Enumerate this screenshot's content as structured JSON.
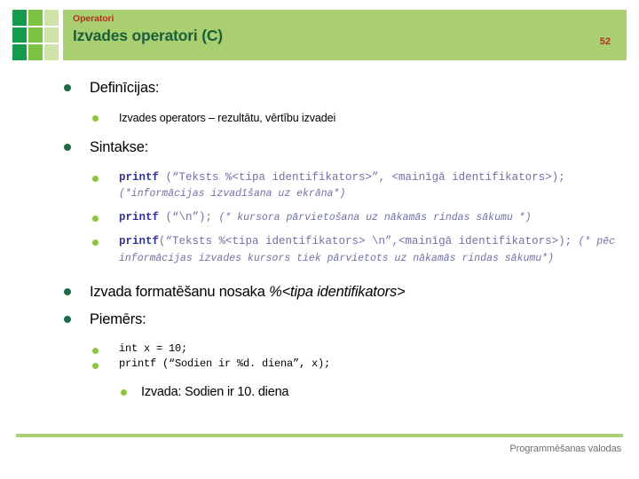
{
  "header": {
    "kicker": "Operatori",
    "title": "Izvades operatori (C)",
    "page_number": "52",
    "bar_color": "#A9CF70",
    "title_color": "#1B5E3A",
    "kicker_color": "#B4301F",
    "logo": {
      "name": "green-squares-logo",
      "cells": [
        "#169B4E",
        "#7DC242",
        "#CDE3A8",
        "#169B4E",
        "#7DC242",
        "#CDE3A8",
        "#169B4E",
        "#7DC242",
        "#CDE3A8"
      ]
    }
  },
  "body": {
    "definitions_heading": "Definīcijas:",
    "definition_item": "Izvades operators – rezultātu, vērtību izvadei",
    "syntax_heading": "Sintakse:",
    "syntax_items": [
      {
        "kw": "printf",
        "code": " (“Teksts %<tipa identifikators>”, <mainīgā identifikators>); ",
        "comment": "(*informācijas izvadīšana uz ekrāna*)"
      },
      {
        "kw": "printf",
        "code": " (“\\n”); ",
        "comment": "(* kursora pārvietošana uz nākamās rindas sākumu *)"
      },
      {
        "kw": "printf",
        "code": "(“Teksts %<tipa identifikators> \\n”,<mainīgā identifikators>); ",
        "comment": "(* pēc informācijas izvades kursors tiek pārvietots uz nākamās rindas sākumu*)"
      }
    ],
    "format_line_prefix": "Izvada formatēšanu nosaka ",
    "format_line_italic": "%<tipa identifikators>",
    "examples_heading": "Piemērs:",
    "examples": [
      "int x = 10;",
      "printf (“Sodien ir %d. diena”, x);"
    ],
    "output_line": "Izvada: Sodien ir 10. diena"
  },
  "footer": {
    "text": "Programmēšanas valodas",
    "rule_color": "#A9CF70"
  },
  "bullet_colors": {
    "level1": "#1F6B45",
    "level2": "#8CC63E",
    "level3": "#8CC63E"
  }
}
